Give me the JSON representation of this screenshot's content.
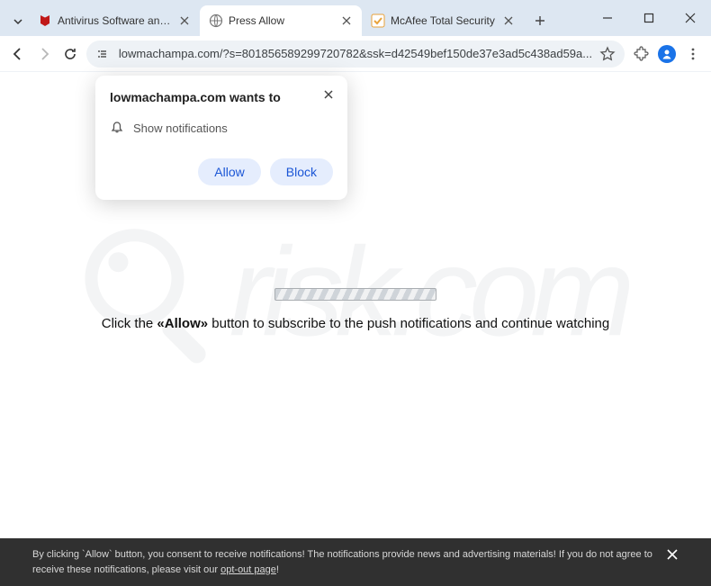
{
  "tabs": [
    {
      "label": "Antivirus Software and Int",
      "favicon": "mcafee",
      "active": false
    },
    {
      "label": "Press Allow",
      "favicon": "globe",
      "active": true
    },
    {
      "label": "McAfee Total Security",
      "favicon": "check",
      "active": false
    }
  ],
  "omnibox": {
    "url": "lowmachampa.com/?s=801856589299720782&ssk=d42549bef150de37e3ad5c438ad59a..."
  },
  "permission": {
    "title": "lowmachampa.com wants to",
    "request": "Show notifications",
    "allow": "Allow",
    "block": "Block"
  },
  "page": {
    "instruction_pre": "Click the ",
    "instruction_bold": "«Allow»",
    "instruction_post": " button to subscribe to the push notifications and continue watching"
  },
  "consent": {
    "text_pre": "By clicking `Allow` button, you consent to receive notifications! The notifications provide news and advertising materials! If you do not agree to receive these notifications, please visit our ",
    "link": "opt-out page",
    "text_post": "!"
  },
  "watermark": {
    "text": "risk.com"
  }
}
